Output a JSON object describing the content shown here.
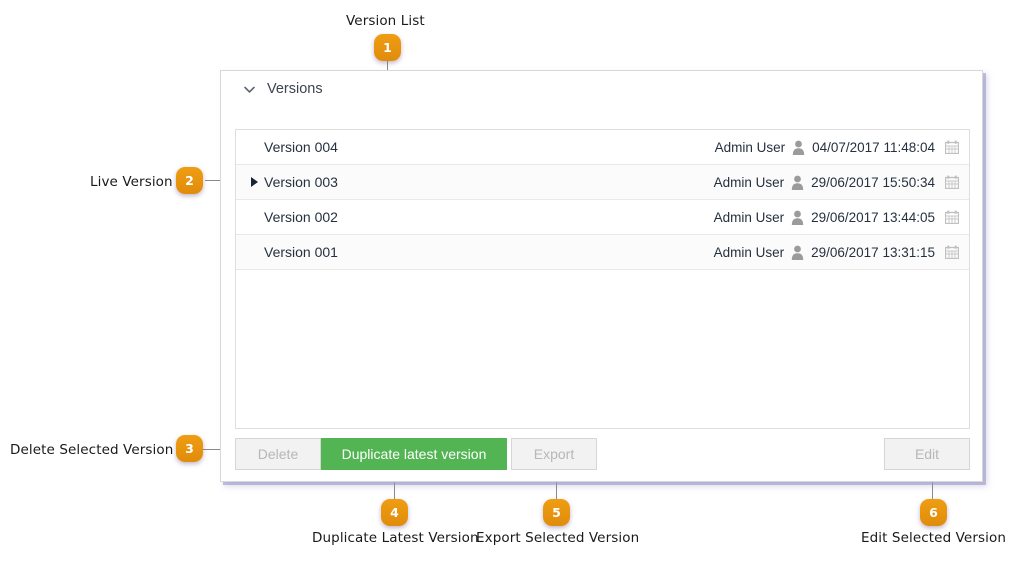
{
  "panel": {
    "title": "Versions",
    "collapse_icon": "chevron-down-icon"
  },
  "version_list": {
    "columns": [
      "name",
      "user",
      "timestamp"
    ],
    "rows": [
      {
        "name": "Version 004",
        "user": "Admin User",
        "timestamp": "04/07/2017 11:48:04",
        "is_live": false
      },
      {
        "name": "Version 003",
        "user": "Admin User",
        "timestamp": "29/06/2017 15:50:34",
        "is_live": true
      },
      {
        "name": "Version 002",
        "user": "Admin User",
        "timestamp": "29/06/2017 13:44:05",
        "is_live": false
      },
      {
        "name": "Version 001",
        "user": "Admin User",
        "timestamp": "29/06/2017 13:31:15",
        "is_live": false
      }
    ]
  },
  "buttons": {
    "delete": "Delete",
    "duplicate": "Duplicate latest version",
    "export": "Export",
    "edit": "Edit"
  },
  "colors": {
    "primary_button": "#52b453",
    "badge": "#e8941a",
    "panel_shadow": "#9691c8",
    "text": "#26313f"
  },
  "annotations": [
    {
      "number": "1",
      "label": "Version List"
    },
    {
      "number": "2",
      "label": "Live Version"
    },
    {
      "number": "3",
      "label": "Delete Selected Version"
    },
    {
      "number": "4",
      "label": "Duplicate Latest Version"
    },
    {
      "number": "5",
      "label": "Export Selected Version"
    },
    {
      "number": "6",
      "label": "Edit Selected Version"
    }
  ]
}
